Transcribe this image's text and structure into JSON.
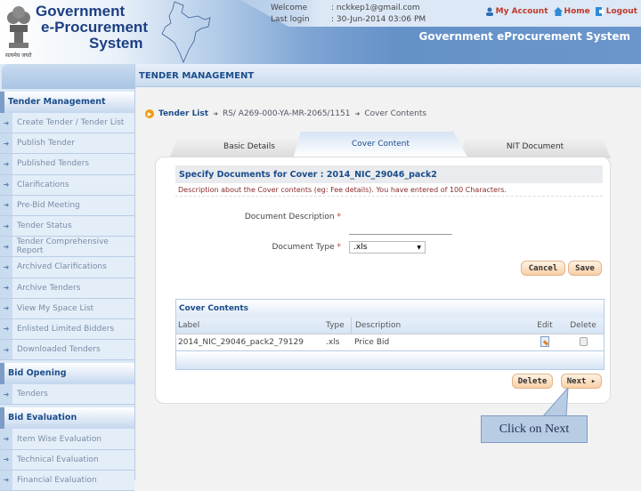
{
  "header": {
    "logo_lines": [
      "Government",
      "e-Procurement",
      "System"
    ],
    "emblem_caption": "सत्यमेव जयते",
    "welcome_label": "Welcome",
    "welcome_value": ": nckkep1@gmail.com",
    "last_login_label": "Last login",
    "last_login_value": ": 30-Jun-2014 03:06 PM",
    "links": [
      {
        "label": "My Account",
        "icon": "user-icon"
      },
      {
        "label": "Home",
        "icon": "home-icon"
      },
      {
        "label": "Logout",
        "icon": "logout-icon"
      }
    ],
    "system_title": "Government eProcurement System"
  },
  "sidebar": {
    "groups": [
      {
        "title": "Tender Management",
        "items": [
          "Create Tender / Tender List",
          "Publish Tender",
          "Published Tenders",
          "Clarifications",
          "Pre-Bid Meeting",
          "Tender Status",
          "Tender Comprehensive Report",
          "Archived Clarifications",
          "Archive Tenders",
          "View My Space List",
          "Enlisted Limited Bidders",
          "Downloaded Tenders"
        ]
      },
      {
        "title": "Bid Opening",
        "items": [
          "Tenders"
        ]
      },
      {
        "title": "Bid Evaluation",
        "items": [
          "Item Wise Evaluation",
          "Technical Evaluation",
          "Financial Evaluation"
        ]
      }
    ]
  },
  "main": {
    "section_title": "TENDER MANAGEMENT",
    "breadcrumb": {
      "root": "Tender List",
      "tender_id": "RS/ A269-000-YA-MR-2065/1151",
      "current": "Cover Contents"
    },
    "tabs": [
      {
        "label": "Basic Details",
        "active": false
      },
      {
        "label": "Cover Content",
        "active": true
      },
      {
        "label": "NIT Document",
        "active": false
      }
    ],
    "form": {
      "heading": "Specify Documents for Cover : 2014_NIC_29046_pack2",
      "note": "Description about the Cover contents (eg: Fee details). You have entered   of 100 Characters.",
      "doc_desc_label": "Document Description",
      "doc_desc_value": "",
      "doc_type_label": "Document Type",
      "doc_type_value": ".xls",
      "required_mark": "*",
      "cancel_label": "Cancel",
      "save_label": "Save"
    },
    "table": {
      "title": "Cover Contents",
      "columns": [
        "Label",
        "Type",
        "Description",
        "Edit",
        "Delete"
      ],
      "rows": [
        {
          "label": "2014_NIC_29046_pack2_79129",
          "type": ".xls",
          "description": "Price Bid"
        }
      ]
    },
    "delete_label": "Delete",
    "next_label": "Next ▸"
  },
  "callout": {
    "text": "Click on Next"
  }
}
